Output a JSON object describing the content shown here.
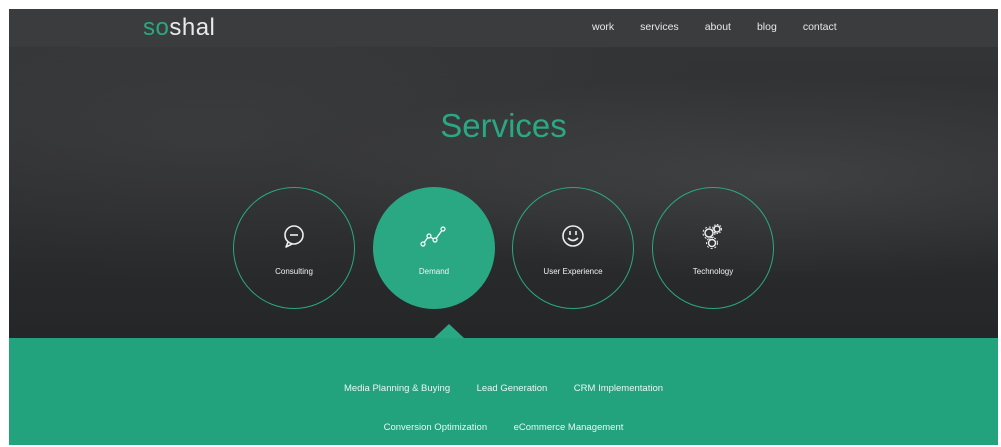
{
  "header": {
    "logo_prefix": "so",
    "logo_suffix": "shal",
    "nav": [
      "work",
      "services",
      "about",
      "blog",
      "contact"
    ]
  },
  "hero": {
    "title": "Services"
  },
  "services": [
    {
      "label": "Consulting",
      "icon": "chat-bubble-icon",
      "active": false
    },
    {
      "label": "Demand",
      "icon": "trend-line-icon",
      "active": true
    },
    {
      "label": "User Experience",
      "icon": "smiley-icon",
      "active": false
    },
    {
      "label": "Technology",
      "icon": "gears-icon",
      "active": false
    }
  ],
  "sub_services": {
    "row1": [
      "Media Planning & Buying",
      "Lead Generation",
      "CRM Implementation"
    ],
    "row2": [
      "Conversion Optimization",
      "eCommerce Management"
    ]
  },
  "colors": {
    "accent": "#2aa883",
    "navbar": "#3b3c3e",
    "hero_dark": "#2b2c2e",
    "panel": "#23a27e"
  }
}
